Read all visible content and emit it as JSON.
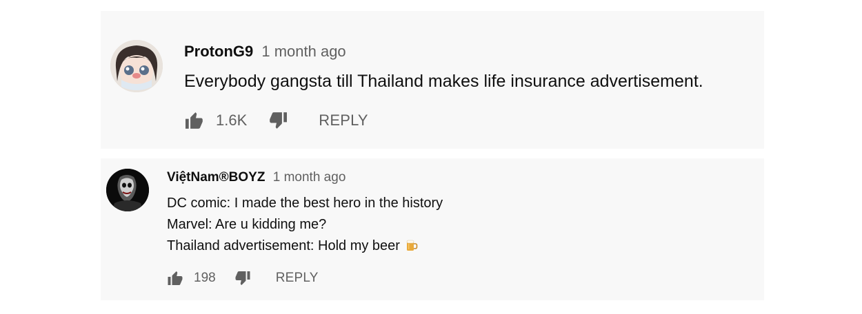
{
  "comments": [
    {
      "author": "ProtonG9",
      "time": "1 month ago",
      "lines": [
        "Everybody gangsta till Thailand makes life insurance advertisement."
      ],
      "likes": "1.6K",
      "reply_label": "REPLY",
      "avatar_icon": "anime-girl-avatar"
    },
    {
      "author": "ViệtNam®BOYZ",
      "time": "1 month ago",
      "lines": [
        "DC comic: I made the best hero in the history",
        "Marvel: Are u kidding me?",
        "Thailand advertisement: Hold my beer"
      ],
      "emoji": "beer-mug-icon",
      "likes": "198",
      "reply_label": "REPLY",
      "avatar_icon": "joker-avatar"
    }
  ],
  "colors": {
    "card_bg": "#f8f8f8",
    "text": "#0f0f0f",
    "secondary": "#606060"
  }
}
